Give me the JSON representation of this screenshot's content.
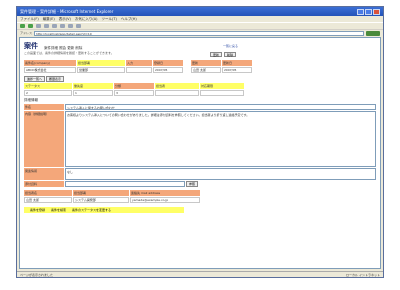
{
  "window": {
    "title": "案件管理 - 案件詳細 - Microsoft Internet Explorer"
  },
  "menubar": [
    "ファイル(F)",
    "編集(E)",
    "表示(V)",
    "お気に入り(A)",
    "ツール(T)",
    "ヘルプ(H)"
  ],
  "address": {
    "label": "アドレス",
    "url": "http://localhost/app/detail.asp?id=10",
    "go_label": "移動"
  },
  "page": {
    "title": "案件",
    "subtitle": "案件詳細 照会 更新 削除",
    "note": "この画面では、案件の詳細情報を確認・更新することができます。",
    "top_link": "一覧に戻る",
    "top_buttons": [
      "更新",
      "削除"
    ]
  },
  "summary": {
    "headers": [
      "案件名(company)",
      "担当部署",
      "入力",
      "登録日",
      "更新",
      "更新日"
    ],
    "values": [
      "ABCD株式会社",
      "営業部",
      "",
      "2007/05",
      "山田 太郎",
      "2007/05"
    ]
  },
  "section1": {
    "labels": [
      "ステータス",
      "優先度",
      "分類",
      "担当者",
      "対応期限",
      "完了予定日"
    ],
    "buttons": [
      "進捗一覧へ",
      "履歴表示"
    ],
    "values": [
      "2",
      "1",
      "3",
      "",
      "",
      ""
    ]
  },
  "form": {
    "section_label": "詳細情報",
    "fields": [
      {
        "label": "件名",
        "value": "システム導入に関するお問い合わせ"
      },
      {
        "label": "内容（詳細説明）",
        "value": "お客様よりシステム導入についての問い合わせがありました。詳細は添付資料を参照してください。担当者より折り返し連絡予定です。"
      },
      {
        "label": "関連情報",
        "value": "なし"
      },
      {
        "label": "添付資料",
        "value": ""
      }
    ],
    "browse_label": "参照"
  },
  "footer_table": {
    "headers": [
      "担当者名",
      "担当部署",
      "連絡先 mail address"
    ],
    "values": [
      "山田 太郎",
      "システム開発部",
      "yamada@example.co.jp"
    ]
  },
  "bottom_links": [
    "案件を登録",
    "案件を検索",
    "案件のステータスを変更する"
  ],
  "status": {
    "left": "ページが表示されました",
    "right": "ローカル イントラネット"
  },
  "colors": {
    "header_bg": "#f4a77a",
    "highlight": "#ffff66",
    "titlebar": "#2352b8"
  }
}
